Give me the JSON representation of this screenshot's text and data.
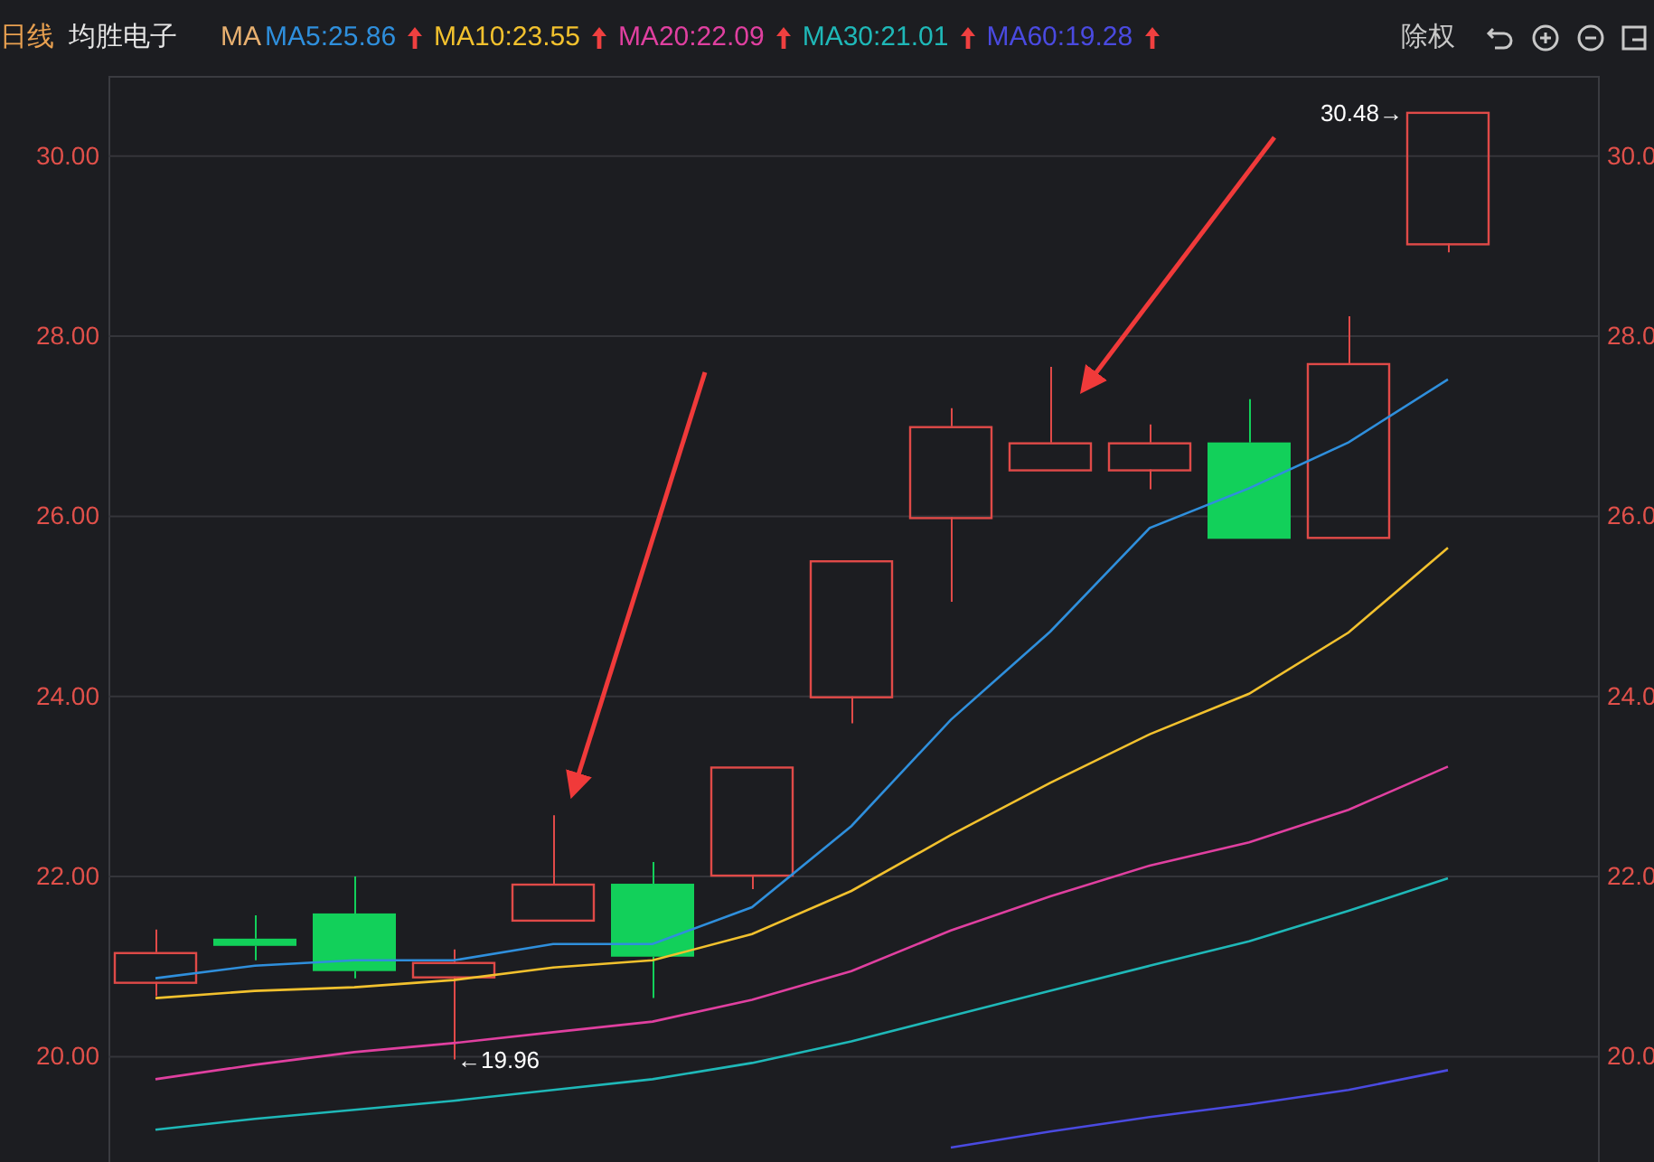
{
  "header": {
    "period": "日线",
    "stock_name": "均胜电子",
    "ma_label": "MA",
    "ma_items": [
      {
        "label": "MA5:25.86",
        "color": "#2f8fdc"
      },
      {
        "label": "MA10:23.55",
        "color": "#f2c12e"
      },
      {
        "label": "MA20:22.09",
        "color": "#e040a0"
      },
      {
        "label": "MA30:21.01",
        "color": "#1fb8b8"
      },
      {
        "label": "MA60:19.28",
        "color": "#4a4ae0"
      }
    ],
    "adjust_label": "除权"
  },
  "right_axis_labels": [
    "30.0",
    "28.0",
    "26.0",
    "24.0",
    "22.0",
    "20.0"
  ],
  "chart": {
    "chart_data": {
      "type": "line",
      "grid": true,
      "ylim": [
        18.82,
        30.88
      ],
      "yticks": [
        {
          "value": 30,
          "label": "30.00"
        },
        {
          "value": 28,
          "label": "28.00"
        },
        {
          "value": 26,
          "label": "26.00"
        },
        {
          "value": 24,
          "label": "24.00"
        },
        {
          "value": 22,
          "label": "22.00"
        },
        {
          "value": 20,
          "label": "20.00"
        }
      ],
      "series": [
        {
          "color": "#2f8fdc",
          "values": [
            20.86,
            21.0,
            21.06,
            21.06,
            21.24,
            21.24,
            21.65,
            22.55,
            23.73,
            24.71,
            25.86,
            26.3,
            26.81,
            27.51
          ]
        },
        {
          "color": "#f2c12e",
          "values": [
            20.64,
            20.72,
            20.76,
            20.84,
            20.98,
            21.06,
            21.35,
            21.83,
            22.45,
            23.03,
            23.57,
            24.02,
            24.7,
            25.64
          ]
        },
        {
          "color": "#e040a0",
          "values": [
            19.74,
            19.9,
            20.04,
            20.14,
            20.26,
            20.38,
            20.62,
            20.94,
            21.39,
            21.77,
            22.11,
            22.37,
            22.73,
            23.21
          ]
        },
        {
          "color": "#1fb8b8",
          "values": [
            19.18,
            19.3,
            19.4,
            19.5,
            19.62,
            19.74,
            19.92,
            20.16,
            20.44,
            20.72,
            21.0,
            21.27,
            21.61,
            21.97
          ]
        },
        {
          "color": "#4a4ae0",
          "values": [
            null,
            null,
            null,
            null,
            null,
            null,
            null,
            null,
            18.98,
            19.16,
            19.32,
            19.46,
            19.62,
            19.84
          ]
        }
      ],
      "annotations": [
        "←19.96",
        "30.48→"
      ]
    }
  }
}
